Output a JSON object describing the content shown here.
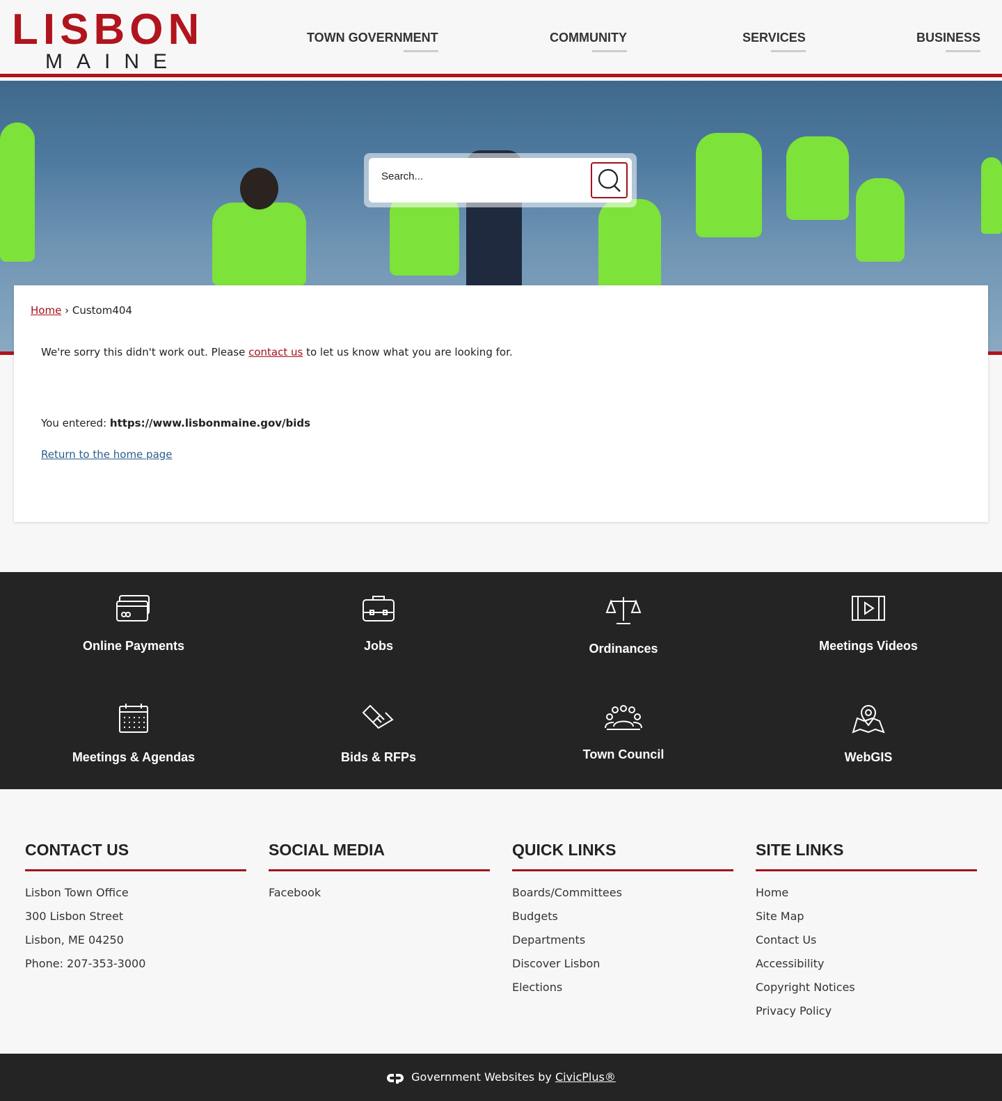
{
  "logo": {
    "line1": "LISBON",
    "line2": "MAINE"
  },
  "nav": [
    "TOWN GOVERNMENT",
    "COMMUNITY",
    "SERVICES",
    "BUSINESS"
  ],
  "search": {
    "placeholder": "Search..."
  },
  "breadcrumb": {
    "home": "Home",
    "sep": "›",
    "current": "Custom404"
  },
  "message": {
    "before": "We're sorry this didn't work out. Please ",
    "link": "contact us",
    "after": " to let us know what you are looking for."
  },
  "entered": {
    "label": "You entered: ",
    "url": "https://www.lisbonmaine.gov/bids"
  },
  "return_link": "Return to the home page",
  "quick_links": [
    {
      "label": "Online Payments",
      "icon": "credit-card-icon"
    },
    {
      "label": "Jobs",
      "icon": "briefcase-icon"
    },
    {
      "label": "Ordinances",
      "icon": "scales-icon"
    },
    {
      "label": "Meetings Videos",
      "icon": "film-icon"
    },
    {
      "label": "Meetings & Agendas",
      "icon": "calendar-icon"
    },
    {
      "label": "Bids & RFPs",
      "icon": "handshake-icon"
    },
    {
      "label": "Town Council",
      "icon": "group-icon"
    },
    {
      "label": "WebGIS",
      "icon": "map-pin-icon"
    }
  ],
  "footer": {
    "contact": {
      "title": "CONTACT US",
      "lines": [
        "Lisbon Town Office",
        "300 Lisbon Street",
        "Lisbon, ME 04250",
        "Phone: 207-353-3000"
      ]
    },
    "social": {
      "title": "SOCIAL MEDIA",
      "links": [
        "Facebook"
      ]
    },
    "quick": {
      "title": "QUICK LINKS",
      "links": [
        "Boards/Committees",
        "Budgets",
        "Departments",
        "Discover Lisbon",
        "Elections"
      ]
    },
    "site": {
      "title": "SITE LINKS",
      "links": [
        "Home",
        "Site Map",
        "Contact Us",
        "Accessibility",
        "Copyright Notices",
        "Privacy Policy"
      ]
    }
  },
  "credit": {
    "text": "Government Websites by ",
    "link": "CivicPlus®"
  }
}
